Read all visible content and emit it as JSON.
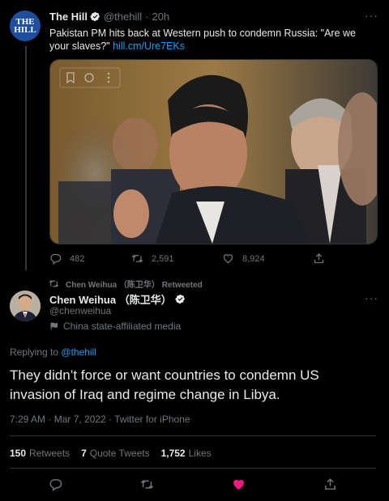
{
  "quoted_tweet": {
    "account_name": "The Hill",
    "handle": "@thehill",
    "separator": "·",
    "time": "20h",
    "avatar_text": "THE HILL",
    "text": "Pakistan PM hits back at Western push to condemn Russia: \"Are we your slaves?\"",
    "link": "hill.cm/Ure7EKs",
    "actions": {
      "replies": "482",
      "retweets": "2,591",
      "likes": "8,924"
    }
  },
  "retweet_label": "Chen Weihua （陈卫华） Retweeted",
  "tweet": {
    "account_name": "Chen Weihua （陈卫华）",
    "handle": "@chenweihua",
    "affiliation": "China state-affiliated media",
    "replying_prefix": "Replying to",
    "replying_to": "@thehill",
    "text": "They didn’t force or want countries to condemn US invasion of Iraq and regime change in Libya.",
    "meta": "7:29 AM · Mar 7, 2022 · Twitter for iPhone",
    "stats": {
      "retweets": "150",
      "retweets_label": "Retweets",
      "quote_tweets": "7",
      "quote_tweets_label": "Quote Tweets",
      "likes": "1,752",
      "likes_label": "Likes"
    }
  },
  "icons": {
    "reply": "reply-icon",
    "retweet": "retweet-icon",
    "like": "heart-icon",
    "share": "share-icon",
    "more": "more-icon",
    "verified": "verified-badge-icon"
  },
  "colors": {
    "background": "#000000",
    "link": "#1d9bf0",
    "muted": "#71767b",
    "liked": "#f91880",
    "verified": "#e7e9ea"
  }
}
